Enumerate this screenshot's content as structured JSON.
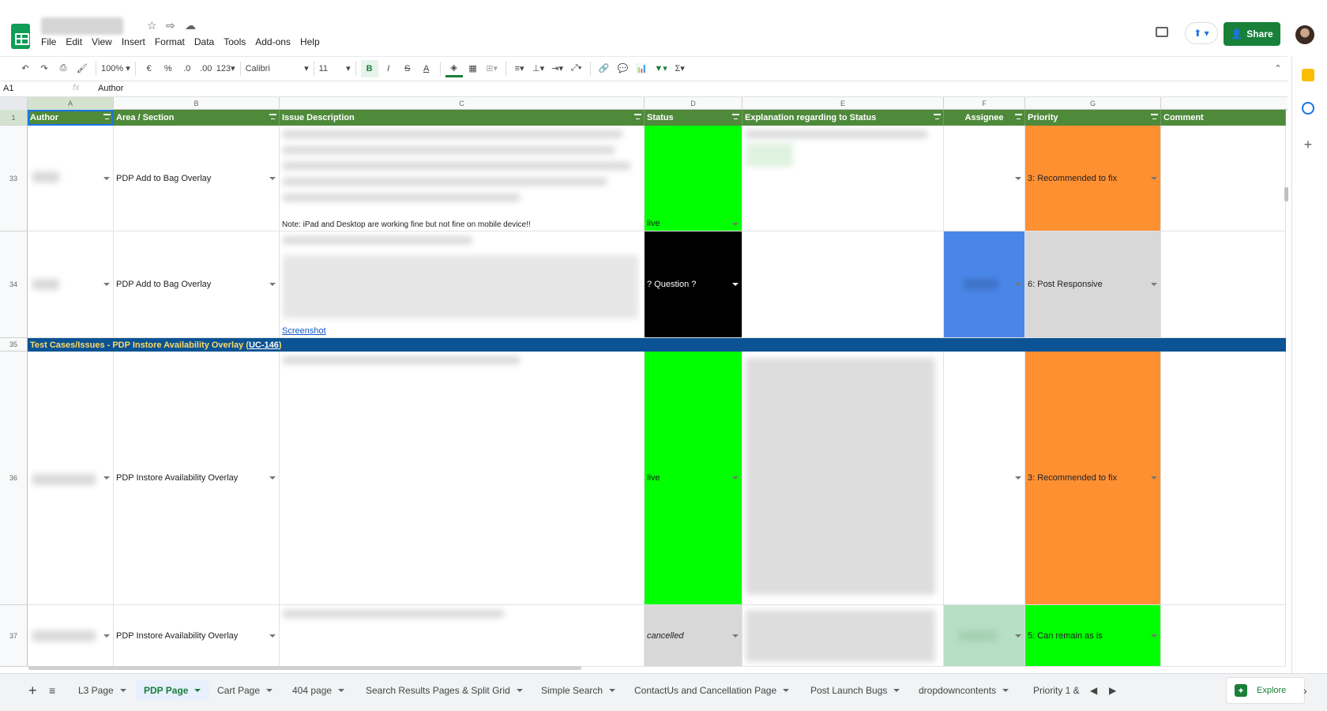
{
  "window": {
    "doc_title_hidden": true
  },
  "menu": [
    "File",
    "Edit",
    "View",
    "Insert",
    "Format",
    "Data",
    "Tools",
    "Add-ons",
    "Help"
  ],
  "header": {
    "share_label": "Share"
  },
  "toolbar": {
    "zoom": "100%",
    "currency": "€",
    "percent": "%",
    "dec_less": ".0",
    "dec_more": ".00",
    "format_more": "123",
    "font": "Calibri",
    "font_size": "11"
  },
  "formula_bar": {
    "cell_ref": "A1",
    "fx": "fx",
    "value": "Author"
  },
  "columns": [
    "A",
    "B",
    "C",
    "D",
    "E",
    "F",
    "G"
  ],
  "header_row": {
    "row_num": "1",
    "author": "Author",
    "area": "Area / Section",
    "issue": "Issue Description",
    "status": "Status",
    "explanation": "Explanation regarding to Status",
    "assignee": "Assignee",
    "priority": "Priority",
    "comment": "Comment"
  },
  "rows": [
    {
      "num": "33",
      "area": "PDP Add to Bag Overlay",
      "issue_note": "Note: iPad and Desktop are working fine but not fine on mobile device!!",
      "status": "live",
      "priority": "3: Recommended to fix"
    },
    {
      "num": "34",
      "area": "PDP Add to Bag Overlay",
      "issue_link": "Screenshot",
      "status": "? Question ?",
      "priority": "6: Post Responsive"
    },
    {
      "num": "35",
      "section_prefix": "Test Cases/Issues - PDP Instore Availability Overlay (",
      "section_link": "UC-146",
      "section_suffix": ")"
    },
    {
      "num": "36",
      "area": "PDP Instore Availability Overlay",
      "status": "live",
      "priority": "3: Recommended to fix"
    },
    {
      "num": "37",
      "area": "PDP Instore Availability Overlay",
      "status": "cancelled",
      "priority": "5: Can remain as is"
    }
  ],
  "sheets": [
    "L3 Page",
    "PDP Page",
    "Cart Page",
    "404 page",
    "Search Results Pages & Split Grid",
    "Simple Search",
    "ContactUs and Cancellation Page",
    "Post Launch Bugs",
    "dropdowncontents",
    "Priority 1 &"
  ],
  "active_sheet": "PDP Page",
  "explore_label": "Explore",
  "colors": {
    "green": "#00ff00",
    "orange": "#ff9032",
    "header_green": "#4e8a3a",
    "section_blue": "#0b5394",
    "assignee_blue": "#4a86e8"
  }
}
